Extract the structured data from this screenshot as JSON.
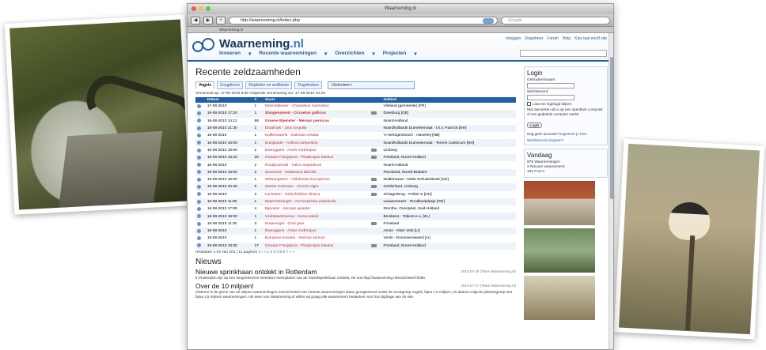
{
  "window": {
    "title": "Waarneming.nl",
    "url": "http://waarneming.nl/index.php",
    "search_placeholder": "Google",
    "tab_label": "Waarneming.nl"
  },
  "site": {
    "logo_main": "Waarneming",
    "logo_tld": ".nl",
    "nav": [
      "Invoeren",
      "Recente waarnemingen",
      "Overzichten",
      "Projecten"
    ],
    "top_links": [
      "Inloggen",
      "Registreer",
      "Forum",
      "Help",
      "Kies taal en/of site"
    ]
  },
  "main": {
    "title": "Recente zeldzaamheden",
    "tabs": [
      "Vogels",
      "Zoogdieren",
      "Reptielen en amfibieën",
      "Dagvlinders"
    ],
    "select_value": "<Selecteer>",
    "refresh_note": "Vernieuwd op: 17-08-2010 9:55 Volgende vernieuwing om: 17-08-2010 10:25",
    "columns": [
      "Datum",
      "#",
      "Soort",
      "Gebied"
    ],
    "rows": [
      {
        "date": "17-08-2010",
        "n": "1",
        "species": "Morinelplevier - Charadrius morinellus",
        "rare": false,
        "photo": false,
        "area": "Vlieland (gemeente) [FR]"
      },
      {
        "date": "16-08-2010 17:20",
        "n": "1",
        "species": "Slangenarend - Circaetus gallicus",
        "rare": true,
        "photo": true,
        "area": "Doesburg [GE]"
      },
      {
        "date": "16-08-2010 14:12",
        "n": "88",
        "species": "Groene Bijeneter - Merops persicus",
        "rare": true,
        "photo": false,
        "area": "Noord-Holland"
      },
      {
        "date": "16-08-2010 21:30",
        "n": "1",
        "species": "Draaihals - Jynx torquilla",
        "rare": false,
        "photo": false,
        "area": "Noordhollands Duinreservaat - t.h.v. Paal 48 [NH]"
      },
      {
        "date": "16-08-2010",
        "n": "1",
        "species": "Kuifleeuwerik - Galerida cristata",
        "rare": false,
        "photo": false,
        "area": "'s-Hertogenbosch - Haverleij [NB]"
      },
      {
        "date": "16-08-2010 16:00",
        "n": "1",
        "species": "Duinpieper - Anthus campestris",
        "rare": false,
        "photo": false,
        "area": "Noordhollands Duinreservaat - Terrein Castricum [NH]"
      },
      {
        "date": "16-08-2010 19:06",
        "n": "2",
        "species": "Dwerggans - Anser erythropus",
        "rare": false,
        "photo": true,
        "area": "Limburg"
      },
      {
        "date": "16-08-2010 16:20",
        "n": "20",
        "species": "Grauwe Franjepoot - Phalaropus lobatus",
        "rare": false,
        "photo": true,
        "area": "Friesland, Noord-Holland"
      },
      {
        "date": "16-08-2010",
        "n": "2",
        "species": "Roodpootvalk - Falco vespertinus",
        "rare": false,
        "photo": false,
        "area": "Noord-Holland"
      },
      {
        "date": "16-08-2010 18:00",
        "n": "2",
        "species": "Zeearend - Haliaeetus albicilla",
        "rare": false,
        "photo": false,
        "area": "Flevoland, Noord-Brabant"
      },
      {
        "date": "16-08-2010 16:00",
        "n": "1",
        "species": "Witwangstern - Chlidonias leucopterus",
        "rare": false,
        "photo": true,
        "area": "Nuldernauw - Delta Schuitenbeek [GE]"
      },
      {
        "date": "16-08-2010 20:45",
        "n": "5",
        "species": "Zwarte Ooievaar - Ciconia nigra",
        "rare": false,
        "photo": true,
        "area": "Gelderland, Limburg"
      },
      {
        "date": "16-08-2010",
        "n": "3",
        "species": "Lachstern - Gelochelidon nilotica",
        "rare": false,
        "photo": true,
        "area": "Schagerbrug - Polder E [NH]"
      },
      {
        "date": "16-08-2010 11:00",
        "n": "1",
        "species": "Waterrietzanger - Acrocephalus paludicola",
        "rare": false,
        "photo": false,
        "area": "Lauwersmeer - Roodkeelplasje [GR]"
      },
      {
        "date": "16-08-2010 17:05",
        "n": "4",
        "species": "Bijeneter - Merops apiaster",
        "rare": false,
        "photo": false,
        "area": "Drenthe, Overijssel, Zuid-Holland"
      },
      {
        "date": "16-08-2010 19:30",
        "n": "1",
        "species": "Vorkstaartmeeuw - Xema sabini",
        "rare": false,
        "photo": false,
        "area": "Breskens - Telpost e.o. [ZL]"
      },
      {
        "date": "16-08-2010 11:30",
        "n": "3",
        "species": "Kraanvogel - Grus grus",
        "rare": false,
        "photo": true,
        "area": "Friesland"
      },
      {
        "date": "15-08-2010",
        "n": "1",
        "species": "Dwerggans - Anser erythropus",
        "rare": false,
        "photo": false,
        "area": "Arcen - Klein Vink [LI]"
      },
      {
        "date": "15-08-2010",
        "n": "1",
        "species": "Europese Kanarie - Serinus serinus",
        "rare": false,
        "photo": false,
        "area": "Venlo - Romeinenweerd [LI]"
      },
      {
        "date": "15-08-2010 18:30",
        "n": "17",
        "species": "Grauwe Franjepoot - Phalaropus lobatus",
        "rare": false,
        "photo": true,
        "area": "Friesland, Noord-Holland"
      }
    ],
    "pager": "resultaten 1-20 van 201 | 11 pagina's |",
    "pager_links": "« < 1 2 3 4 5 6 7 > »"
  },
  "news": {
    "heading": "Nieuws",
    "items": [
      {
        "title": "Nieuwe sprinkhaan ontdekt in Rotterdam",
        "meta": "2010-07-29 (Team Waarneming.nl)",
        "body": "In Rotterdam zijn op een rangeerterrein meerdere exemplaren van de Kiezelsprinkhaan ontdekt, zie ook http://waarneming.nl/soort/view/70080."
      },
      {
        "title": "Over de 10 miljoen!",
        "meta": "2010-07-17 (Team Waarneming.nl)",
        "body": "Gisteren is de grens van 10 miljoen waarnemingen overschreden! De meeste waarnemingen staan geregistreerd onder de soortgroep vogels, bijna 7,5 miljoen, en daarna volgt de plantengroep met bijna 1,5 miljoen waarnemingen. Als team van Waarneming.nl willen wij graag alle waarnemers bedanken voor hun bijdrage aan de site."
      }
    ]
  },
  "login": {
    "heading": "Login",
    "user_label": "Gebruikersnaam",
    "pass_label": "Wachtwoord",
    "remember": "Laat me ingelogd blijven",
    "warning": "Niet aanvinken als u op een openbare computer of een gedeelde computer werkt!",
    "button": "Login",
    "no_account": "Nog geen account?",
    "register": "Registreer je hier!",
    "forgot": "Wachtwoord vergeten?"
  },
  "today": {
    "heading": "Vandaag",
    "line1": "975 Waarnemingen",
    "line2": "2 Nieuwe waarnemers",
    "line3_num": "194",
    "line3_link": "Foto's"
  }
}
